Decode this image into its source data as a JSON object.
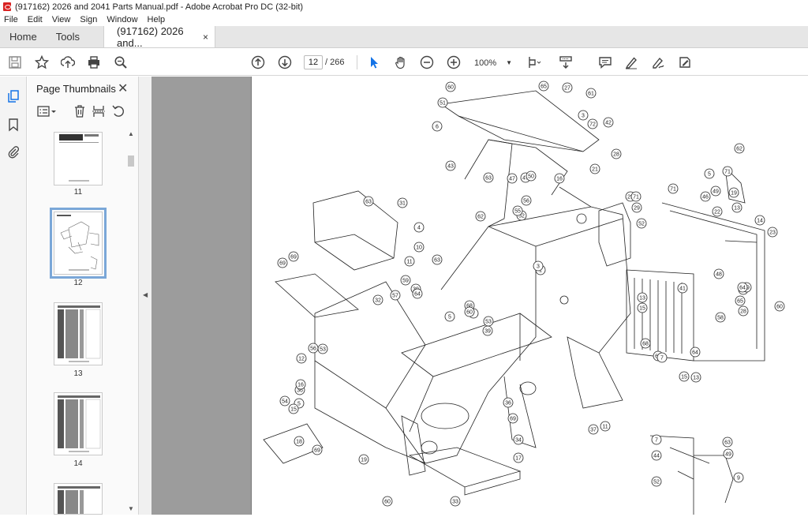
{
  "window": {
    "title": "(917162) 2026 and 2041 Parts Manual.pdf - Adobe Acrobat Pro DC (32-bit)"
  },
  "menu": [
    "File",
    "Edit",
    "View",
    "Sign",
    "Window",
    "Help"
  ],
  "tabs": {
    "home": "Home",
    "tools": "Tools",
    "document": "(917162) 2026 and...",
    "close": "×"
  },
  "toolbar": {
    "current_page": "12",
    "total_pages": "/ 266",
    "zoom": "100%",
    "icons": [
      "save-icon",
      "bookmark-star-icon",
      "upload-icon",
      "print-icon",
      "search-zoom-icon",
      "prev-page-icon",
      "next-page-icon",
      "select-cursor-icon",
      "hand-icon",
      "zoom-out-icon",
      "zoom-in-icon",
      "page-fit-icon",
      "scroll-mode-icon",
      "comment-icon",
      "highlight-pen-icon",
      "sign-icon",
      "fill-sign-icon"
    ]
  },
  "sidebar": {
    "panel_title": "Page Thumbnails",
    "thumbnails": [
      {
        "label": "11"
      },
      {
        "label": "12"
      },
      {
        "label": "13"
      },
      {
        "label": "14"
      }
    ]
  },
  "drawing": {
    "callouts_main": [
      "60",
      "51",
      "6",
      "65",
      "27",
      "61",
      "3",
      "72",
      "42",
      "28",
      "21",
      "43",
      "47",
      "47",
      "50",
      "16",
      "29",
      "63",
      "62",
      "52",
      "56",
      "55",
      "4",
      "10",
      "11",
      "39",
      "1",
      "3",
      "63",
      "31",
      "69",
      "69",
      "32",
      "59",
      "64",
      "63",
      "53",
      "56",
      "12",
      "57",
      "68",
      "39",
      "7",
      "5",
      "53",
      "60",
      "36",
      "36",
      "5",
      "54",
      "16",
      "15",
      "69",
      "34",
      "18",
      "69",
      "17",
      "19",
      "60",
      "33",
      "37",
      "11",
      "71",
      "29",
      "52",
      "71",
      "62",
      "5",
      "49",
      "46",
      "22",
      "71",
      "19",
      "13",
      "23",
      "14",
      "48",
      "4",
      "49",
      "65",
      "28",
      "64",
      "13",
      "15",
      "41",
      "67",
      "68",
      "7",
      "64",
      "58",
      "13",
      "15",
      "7",
      "63",
      "44",
      "49",
      "52",
      "9",
      "60"
    ]
  }
}
